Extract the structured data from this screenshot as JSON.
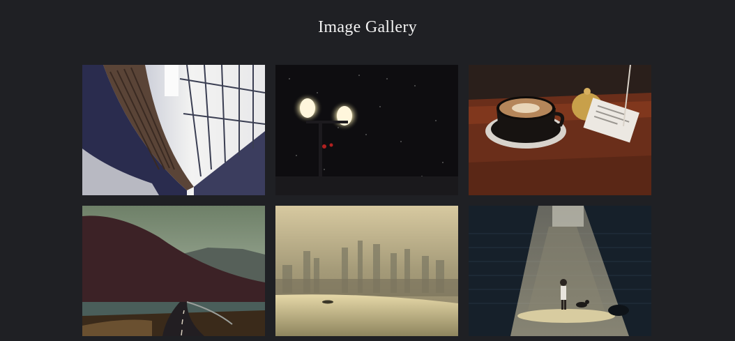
{
  "page": {
    "title": "Image Gallery"
  },
  "gallery": {
    "images": [
      {
        "subject": "library",
        "icon": "library-photo"
      },
      {
        "subject": "street-lamp-night",
        "icon": "lamp-photo"
      },
      {
        "subject": "coffee-cup",
        "icon": "coffee-photo"
      },
      {
        "subject": "mountain-road",
        "icon": "mountain-photo"
      },
      {
        "subject": "foggy-city",
        "icon": "city-photo"
      },
      {
        "subject": "child-in-light",
        "icon": "light-photo"
      }
    ]
  },
  "colors": {
    "background": "#1f2024",
    "title_text": "#f2f2f2"
  }
}
